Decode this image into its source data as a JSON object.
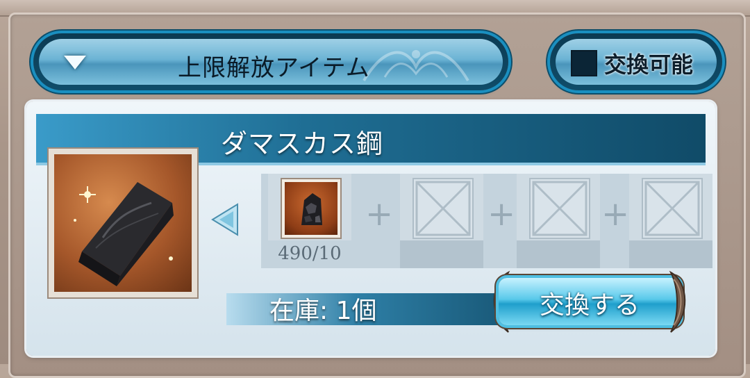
{
  "filter": {
    "selected_label": "上限解放アイテム"
  },
  "exchange_toggle": {
    "label": "交換可能",
    "checked": false
  },
  "item": {
    "name": "ダマスカス鋼",
    "icon": "damascus-steel-ingot-icon",
    "stock": "在庫: 1個",
    "exchange_button": "交換する",
    "materials": [
      {
        "icon": "ore-material-icon",
        "count": "490/10"
      },
      {
        "icon": "empty-slot-icon",
        "count": ""
      },
      {
        "icon": "empty-slot-icon",
        "count": ""
      },
      {
        "icon": "empty-slot-icon",
        "count": ""
      }
    ]
  },
  "colors": {
    "accent_blue": "#1a8fc0",
    "header_dark": "#104b68",
    "item_bg_orange": "#a5572a"
  }
}
